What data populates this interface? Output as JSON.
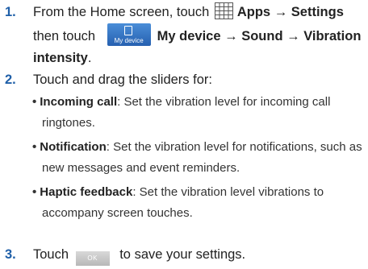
{
  "steps": [
    {
      "num": "1.",
      "lead": "From the Home screen, touch",
      "apps_label": "Apps → Settings",
      "then": "then touch",
      "mydevice_icon_text": "My device",
      "path_label": "My device → Sound → Vibration intensity",
      "end": "."
    },
    {
      "num": "2.",
      "text": "Touch and drag the sliders for:",
      "bullets": [
        {
          "term": "Incoming call",
          "line1": ": Set the vibration level for incoming call",
          "line2": "ringtones."
        },
        {
          "term": "Notification",
          "line1": ": Set the vibration level for notifications, such as",
          "line2": "new messages and event reminders."
        },
        {
          "term": "Haptic feedback",
          "line1": ": Set the vibration level vibrations to",
          "line2": "accompany screen touches."
        }
      ]
    },
    {
      "num": "3.",
      "lead": "Touch",
      "ok_label": "OK",
      "tail": "to save your settings."
    }
  ],
  "icons": {
    "apps": "apps-grid-icon",
    "mydevice": "my-device-icon"
  },
  "colors": {
    "step_number": "#1f5fa8",
    "text": "#222222"
  }
}
